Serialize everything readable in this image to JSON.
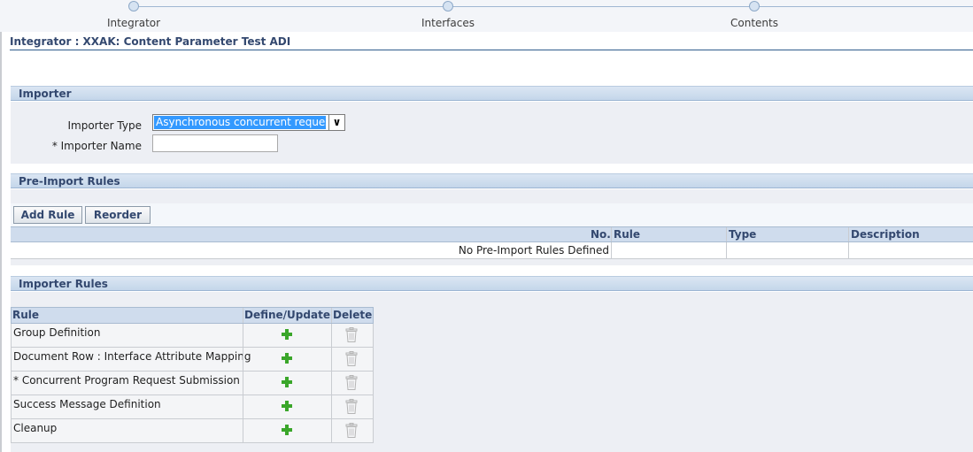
{
  "train": {
    "steps": [
      "Integrator",
      "Interfaces",
      "Contents"
    ]
  },
  "page_title": "Integrator : XXAK: Content Parameter Test ADI",
  "importer": {
    "header": "Importer",
    "importer_type_label": "Importer Type",
    "importer_type_value": "Asynchronous concurrent request",
    "importer_name_label": "* Importer Name",
    "importer_name_value": ""
  },
  "pre_import": {
    "header": "Pre-Import Rules",
    "add_rule_label": "Add Rule",
    "reorder_label": "Reorder",
    "columns": [
      "No.",
      "Rule",
      "Type",
      "Description"
    ],
    "empty_message": "No Pre-Import Rules Defined"
  },
  "importer_rules": {
    "header": "Importer Rules",
    "columns": [
      "Rule",
      "Define/Update",
      "Delete"
    ],
    "rows": [
      {
        "rule": "Group Definition"
      },
      {
        "rule": "Document Row : Interface Attribute Mapping"
      },
      {
        "rule": "* Concurrent Program Request Submission"
      },
      {
        "rule": "Success Message Definition"
      },
      {
        "rule": "Cleanup"
      }
    ]
  },
  "colors": {
    "accent": "#33486f",
    "header_band": "#c4d6ea",
    "selection": "#3399ff",
    "add_icon": "#3aa62a"
  }
}
